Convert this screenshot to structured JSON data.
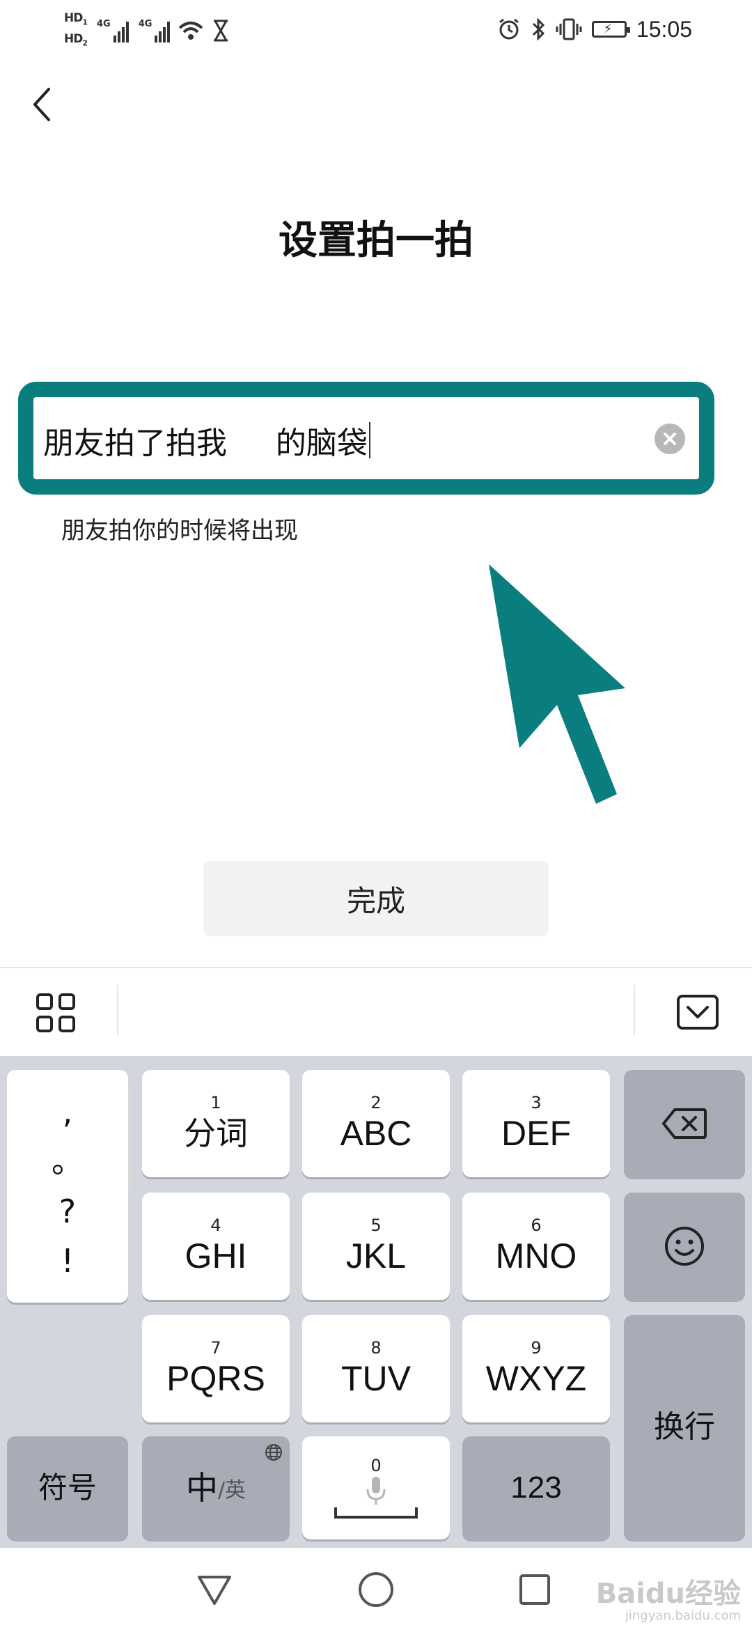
{
  "status_bar": {
    "hd1": "HD",
    "hd1_sub": "1",
    "hd2": "HD",
    "hd2_sub": "2",
    "net1": "4G",
    "net2": "4G",
    "time": "15:05"
  },
  "header": {
    "back_icon": "chevron-left-icon",
    "title": "设置拍一拍"
  },
  "input": {
    "value": "朋友拍了拍我     的脑袋",
    "clear_icon": "clear-circle-icon",
    "hint": "朋友拍你的时候将出现",
    "highlight_color": "#0a7e7e"
  },
  "annotation": {
    "arrow_color": "#0a7e7e"
  },
  "done_button": {
    "label": "完成"
  },
  "keyboard": {
    "punctuation": [
      ",",
      "。",
      "?",
      "!"
    ],
    "keys": [
      {
        "num": "1",
        "label": "分词"
      },
      {
        "num": "2",
        "label": "ABC"
      },
      {
        "num": "3",
        "label": "DEF"
      },
      {
        "num": "4",
        "label": "GHI"
      },
      {
        "num": "5",
        "label": "JKL"
      },
      {
        "num": "6",
        "label": "MNO"
      },
      {
        "num": "7",
        "label": "PQRS"
      },
      {
        "num": "8",
        "label": "TUV"
      },
      {
        "num": "9",
        "label": "WXYZ"
      }
    ],
    "symbols_label": "符号",
    "lang_main": "中",
    "lang_sub": "/英",
    "space_num": "0",
    "numbers_label": "123",
    "enter_label": "换行"
  },
  "watermark": {
    "line1": "Baidu经验",
    "line2": "jingyan.baidu.com"
  }
}
